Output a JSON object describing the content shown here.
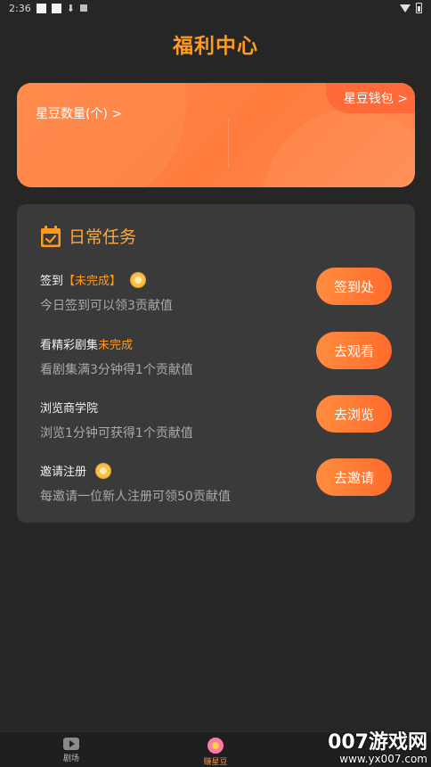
{
  "status_bar": {
    "time": "2:36"
  },
  "page": {
    "title": "福利中心"
  },
  "bean_card": {
    "count_label": "星豆数量(个) >",
    "wallet_label": "星豆钱包 >"
  },
  "daily_tasks": {
    "title": "日常任务",
    "items": [
      {
        "name": "签到",
        "status": "【未完成】",
        "coin": true,
        "desc": "今日签到可以领3贡献值",
        "button": "签到处"
      },
      {
        "name": "看精彩剧集",
        "status": "未完成",
        "coin": false,
        "desc": "看剧集满3分钟得1个贡献值",
        "button": "去观看"
      },
      {
        "name": "浏览商学院",
        "status": "",
        "coin": false,
        "desc": "浏览1分钟可获得1个贡献值",
        "button": "去浏览"
      },
      {
        "name": "邀请注册",
        "status": "",
        "coin": true,
        "desc": "每邀请一位新人注册可领50贡献值",
        "button": "去邀请"
      }
    ]
  },
  "tab_bar": {
    "items": [
      {
        "label": "剧场",
        "icon": "theater-icon"
      },
      {
        "label": "赚星豆",
        "icon": "bean-icon"
      }
    ]
  },
  "watermark": {
    "main": "007游戏网",
    "sub": "www.yx007.com"
  },
  "colors": {
    "accent": "#ff9a1f",
    "card_orange": "#ff7b3e",
    "background": "#262626",
    "card_dark": "#3a3a3a"
  }
}
